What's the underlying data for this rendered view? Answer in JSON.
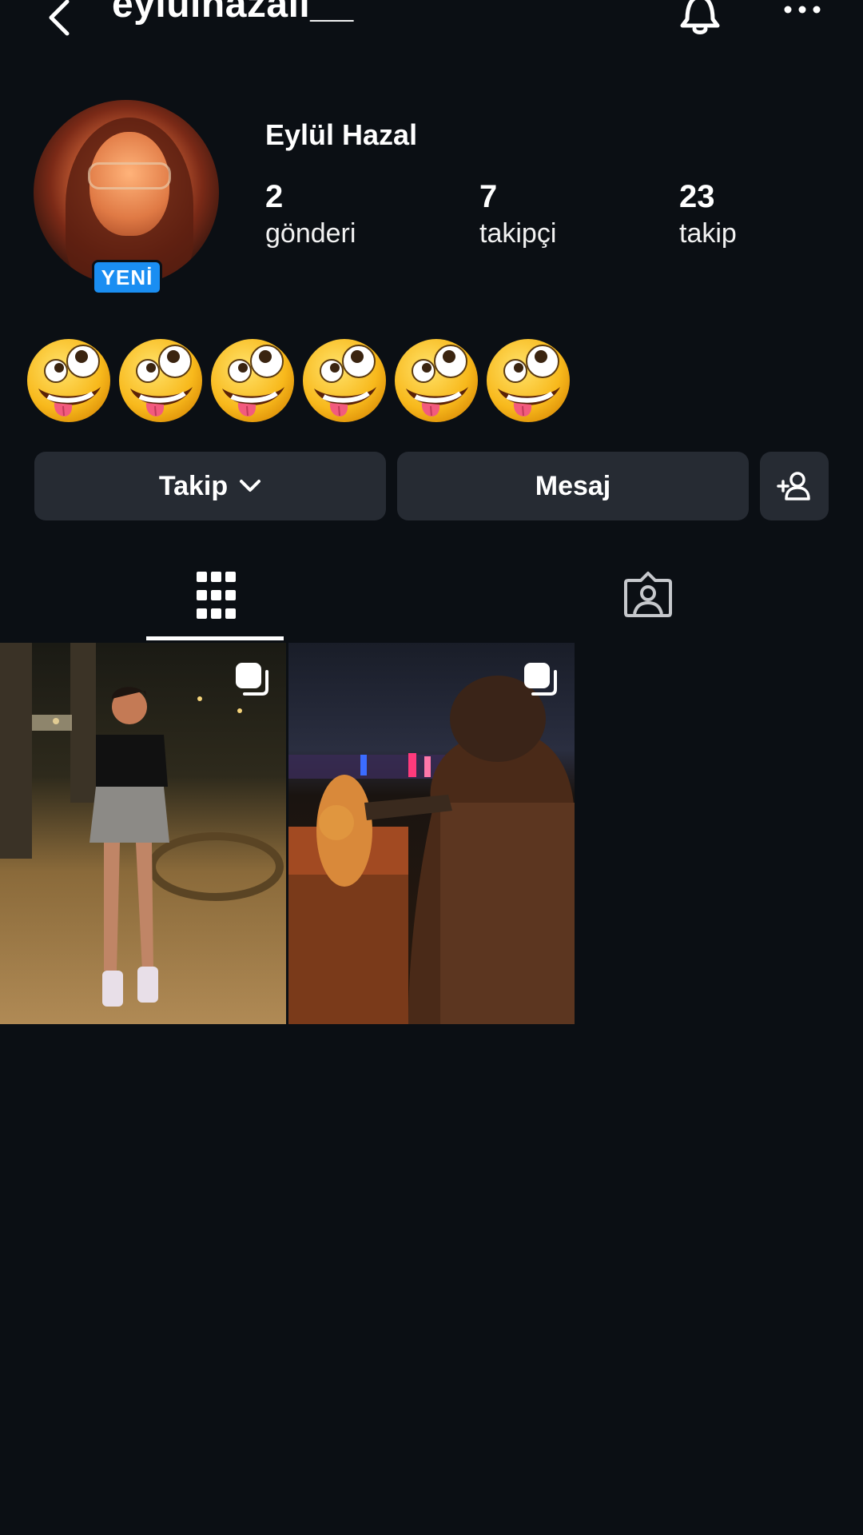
{
  "header": {
    "username": "eylulhazall__"
  },
  "profile": {
    "display_name": "Eylül Hazal",
    "badge": "YENİ",
    "stats": {
      "posts": {
        "value": "2",
        "label": "gönderi"
      },
      "followers": {
        "value": "7",
        "label": "takipçi"
      },
      "following": {
        "value": "23",
        "label": "takip"
      }
    },
    "bio_emojis": [
      "zany-face",
      "zany-face",
      "zany-face",
      "zany-face",
      "zany-face",
      "zany-face"
    ]
  },
  "actions": {
    "follow_label": "Takip",
    "message_label": "Mesaj"
  },
  "tabs": [
    {
      "name": "grid",
      "active": true
    },
    {
      "name": "tagged",
      "active": false
    }
  ],
  "posts": [
    {
      "type": "carousel",
      "scene": "night-street-portrait"
    },
    {
      "type": "carousel",
      "scene": "night-city-cat"
    }
  ],
  "colors": {
    "background": "#0b0f14",
    "button_bg": "#262b33",
    "badge_blue": "#1a8ef2",
    "text": "#ffffff"
  }
}
